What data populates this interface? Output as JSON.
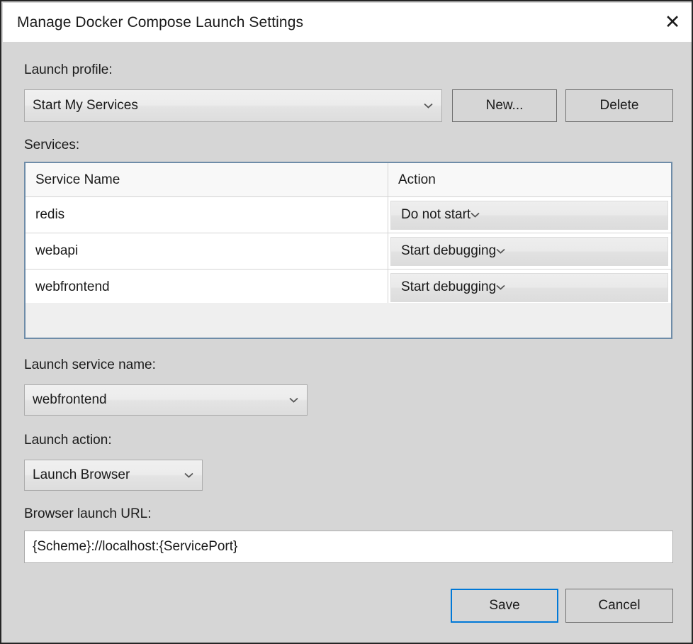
{
  "window": {
    "title": "Manage Docker Compose Launch Settings",
    "close_icon": "close-icon"
  },
  "form": {
    "launch_profile_label": "Launch profile:",
    "launch_profile_value": "Start My Services",
    "new_button": "New...",
    "delete_button": "Delete",
    "services_label": "Services:",
    "launch_service_name_label": "Launch service name:",
    "launch_service_name_value": "webfrontend",
    "launch_action_label": "Launch action:",
    "launch_action_value": "Launch Browser",
    "browser_launch_url_label": "Browser launch URL:",
    "browser_launch_url_value": "{Scheme}://localhost:{ServicePort}"
  },
  "services_table": {
    "columns": [
      "Service Name",
      "Action"
    ],
    "rows": [
      {
        "name": "redis",
        "action": "Do not start"
      },
      {
        "name": "webapi",
        "action": "Start debugging"
      },
      {
        "name": "webfrontend",
        "action": "Start debugging"
      }
    ]
  },
  "footer": {
    "save_button": "Save",
    "cancel_button": "Cancel"
  },
  "colors": {
    "dialog_background": "#d6d6d6",
    "dialog_border": "#262626",
    "grid_border": "#6e8ca8",
    "accent_focus": "#0078d7",
    "text": "#1a1a1a"
  }
}
